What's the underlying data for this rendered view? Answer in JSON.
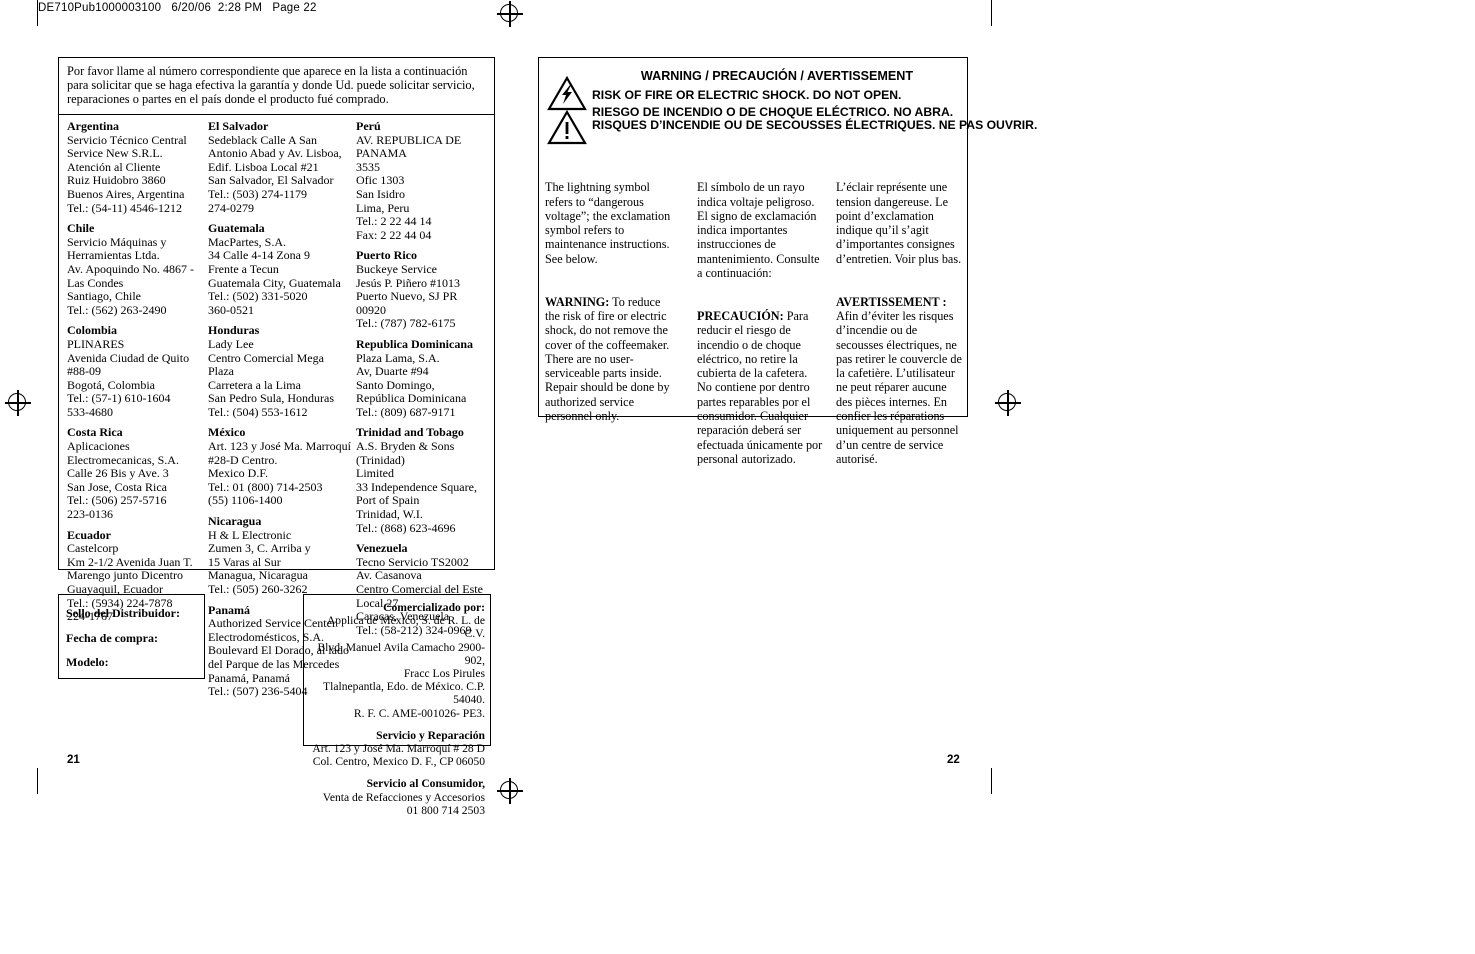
{
  "header": {
    "print_header": "DE710Pub1000003100   6/20/06  2:28 PM   Page 22"
  },
  "left_panel": {
    "intro": "Por favor llame al número correspondiente que aparece en la lista a continuación para solicitar que se haga efectiva la garantía y donde Ud. puede solicitar servicio, reparaciones o partes en el país donde el producto fué comprado.",
    "columns": [
      {
        "entries": [
          {
            "country": "Argentina",
            "lines": "Servicio Técnico Central\nService New S.R.L.\nAtención al Cliente\nRuiz Huidobro 3860\nBuenos Aires, Argentina\nTel.: (54-11) 4546-1212"
          },
          {
            "country": "Chile",
            "lines": "Servicio Máquinas y\nHerramientas Ltda.\nAv. Apoquindo No. 4867 -\nLas Condes\nSantiago, Chile\nTel.: (562) 263-2490"
          },
          {
            "country": "Colombia",
            "lines": "PLINARES\nAvenida Ciudad de Quito\n#88-09\nBogotá, Colombia\nTel.: (57-1) 610-1604\n          533-4680"
          },
          {
            "country": "Costa Rica",
            "lines": "Aplicaciones\nElectromecanicas, S.A.\nCalle 26 Bis y Ave. 3\nSan Jose, Costa Rica\nTel.: (506) 257-5716\n          223-0136"
          },
          {
            "country": "Ecuador",
            "lines": "Castelcorp\nKm 2-1/2 Avenida Juan T.\nMarengo junto Dicentro\nGuayaquil, Ecuador\nTel.: (5934) 224-7878\n          224-1767"
          }
        ]
      },
      {
        "entries": [
          {
            "country": "El Salvador",
            "lines": "Sedeblack Calle A San\nAntonio Abad y Av. Lisboa,\nEdif. Lisboa Local #21\nSan Salvador, El Salvador\nTel.: (503) 274-1179\n          274-0279"
          },
          {
            "country": "Guatemala",
            "lines": "MacPartes, S.A.\n34 Calle 4-14 Zona 9\nFrente a Tecun\nGuatemala City, Guatemala\nTel.: (502) 331-5020\n          360-0521"
          },
          {
            "country": "Honduras",
            "lines": "Lady Lee\nCentro Comercial Mega Plaza\nCarretera a la Lima\nSan Pedro Sula, Honduras\nTel.: (504) 553-1612"
          },
          {
            "country": "México",
            "lines": "Art. 123 y José Ma. Marroquí\n#28-D Centro.\nMexico D.F.\nTel.: 01 (800) 714-2503\n          (55) 1106-1400"
          },
          {
            "country": "Nicaragua",
            "lines": "H & L Electronic\nZumen 3, C. Arriba y\n15 Varas al Sur\nManagua, Nicaragua\nTel.: (505) 260-3262"
          },
          {
            "country": "Panamá",
            "lines": "Authorized Service Center\nElectrodomésticos, S.A.\nBoulevard El Dorado, al lado\ndel Parque de las Mercedes\nPanamá, Panamá\nTel.: (507) 236-5404"
          }
        ]
      },
      {
        "entries": [
          {
            "country": "Perú",
            "lines": "AV. REPUBLICA DE PANAMA\n3535\nOfic 1303\nSan Isidro\nLima, Peru\nTel.: 2 22 44 14\nFax: 2 22 44 04"
          },
          {
            "country": "Puerto Rico",
            "lines": "Buckeye Service\nJesús P. Piñero #1013\nPuerto Nuevo, SJ PR  00920\nTel.: (787) 782-6175"
          },
          {
            "country": "Republica Dominicana",
            "lines": "Plaza Lama, S.A.\nAv, Duarte #94\nSanto Domingo,\nRepública Dominicana\nTel.: (809) 687-9171"
          },
          {
            "country": "Trinidad and Tobago",
            "lines": "A.S. Bryden & Sons (Trinidad)\nLimited\n33 Independence Square,\nPort of Spain\nTrinidad, W.I.\nTel.: (868) 623-4696"
          },
          {
            "country": "Venezuela",
            "lines": "Tecno Servicio TS2002\nAv. Casanova\nCentro Comercial del Este\nLocal 27\nCaracas, Venezuela\nTel.: (58-212) 324-0969"
          }
        ]
      }
    ]
  },
  "distributor_box": {
    "line1": "Sello del Distribuidor:",
    "line2": "Fecha de compra:",
    "line3": "Modelo:"
  },
  "commercial_box": {
    "heading1": "Comercializado por:",
    "body1": "Applica de México, S. de R. L. de C.V.\nBlvd. Manuel Avila Camacho 2900-902,\nFracc Los Pirules\nTlalnepantla, Edo. de México. C.P. 54040.\nR. F. C. AME-001026- PE3.",
    "heading2": "Servicio y Reparación",
    "body2": "Art. 123 y José Ma. Marroquí # 28 D\nCol. Centro, Mexico D. F., CP 06050",
    "heading3": "Servicio al Consumidor,",
    "body3": "Venta de Refacciones y Accesorios\n01 800  714 2503"
  },
  "warning_panel": {
    "title": "WARNING / PRECAUCIÓN / AVERTISSEMENT",
    "line_en": "RISK OF FIRE OR ELECTRIC SHOCK. DO NOT OPEN.",
    "line_es": "RIESGO DE INCENDIO O DE CHOQUE ELÉCTRICO. NO ABRA.",
    "line_fr": "RISQUES D’INCENDIE OU DE SECOUSSES ÉLECTRIQUES. NE PAS OUVRIR.",
    "icons": {
      "bolt": "lightning-bolt-triangle-icon",
      "exclamation": "exclamation-triangle-icon"
    },
    "col_en_1": "The lightning symbol refers to “dangerous voltage”; the exclamation symbol refers to maintenance instructions. See below.",
    "col_en_label": "WARNING:",
    "col_en_2": "  To reduce the risk of fire or electric shock, do not remove the cover of the coffeemaker. There are no user-serviceable parts inside. Repair should be done by authorized service personnel only.",
    "col_es_1": "El símbolo de un rayo indica voltaje peligroso. El signo de exclamación indica  importantes instrucciones de mantenimiento. Consulte a continuación:",
    "col_es_label": "PRECAUCIÓN:",
    "col_es_2": " Para reducir el riesgo de incendio o de choque eléctrico, no retire la cubierta de la cafetera. No contiene por dentro partes reparables por el consumidor. Cualquier reparación deberá ser efectuada únicamente por personal autorizado.",
    "col_fr_1": "L’éclair représente une tension dangereuse. Le point d’exclamation indique qu’il s’agit d’importantes consignes d’entretien. Voir plus bas.",
    "col_fr_label": "AVERTISSEMENT :",
    "col_fr_2": " Afin d’éviter les risques d’incendie ou de secousses électriques, ne pas retirer le couvercle de la cafetière. L’utilisateur ne peut réparer aucune des pièces internes. En confier les réparations uniquement au personnel d’un centre de service autorisé."
  },
  "page_numbers": {
    "left": "21",
    "right": "22"
  }
}
